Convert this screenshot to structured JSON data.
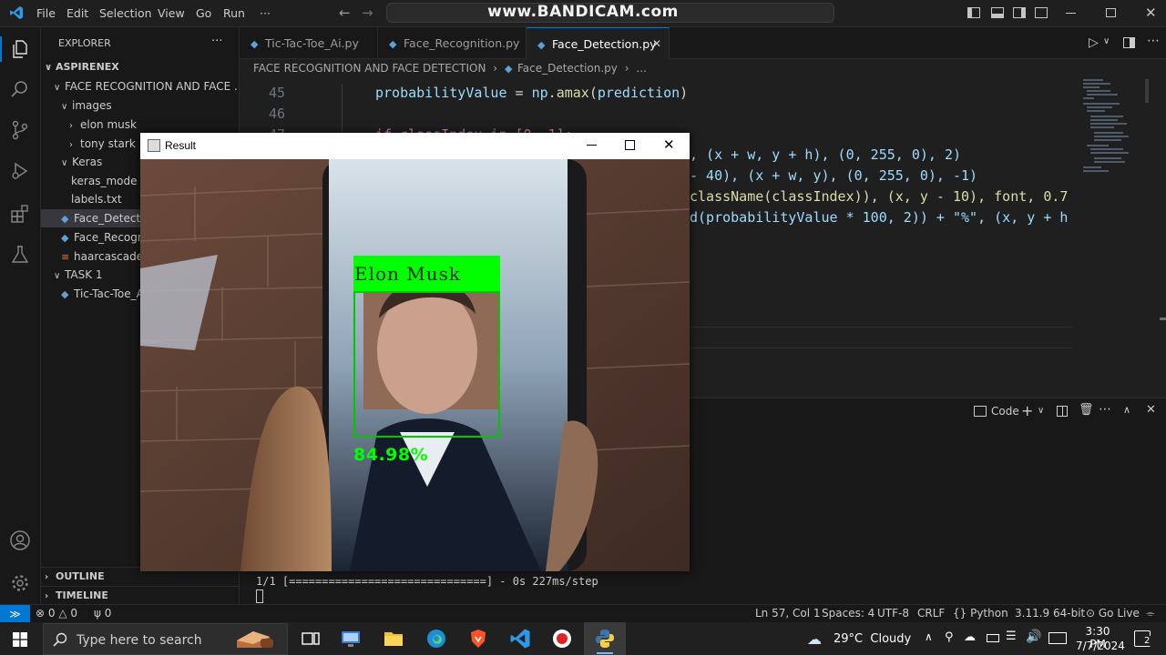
{
  "titlebar": {
    "menu": [
      "File",
      "Edit",
      "Selection",
      "View",
      "Go",
      "Run",
      "···"
    ],
    "watermark": "www.BANDICAM.com"
  },
  "sidebar": {
    "header": "EXPLORER",
    "more": "···",
    "workspace": "ASPIRENEX",
    "tree": [
      {
        "label": "FACE RECOGNITION AND FACE ...",
        "kind": "folder",
        "open": true
      },
      {
        "label": "images",
        "kind": "folder",
        "open": true
      },
      {
        "label": "elon musk",
        "kind": "folder",
        "open": false
      },
      {
        "label": "tony stark",
        "kind": "folder",
        "open": false
      },
      {
        "label": "Keras",
        "kind": "folder",
        "open": true
      },
      {
        "label": "keras_mode",
        "kind": "file"
      },
      {
        "label": "labels.txt",
        "kind": "file"
      },
      {
        "label": "Face_Detecti",
        "kind": "py",
        "selected": true
      },
      {
        "label": "Face_Recogn",
        "kind": "py"
      },
      {
        "label": "haarcascade_",
        "kind": "xml"
      },
      {
        "label": "TASK 1",
        "kind": "folder",
        "open": true
      },
      {
        "label": "Tic-Tac-Toe_A",
        "kind": "py"
      }
    ],
    "outline": "OUTLINE",
    "timeline": "TIMELINE"
  },
  "tabs": [
    {
      "label": "Tic-Tac-Toe_Ai.py",
      "active": false
    },
    {
      "label": "Face_Recognition.py",
      "active": false
    },
    {
      "label": "Face_Detection.py",
      "active": true,
      "close": "✕"
    }
  ],
  "breadcrumb": {
    "folder": "FACE RECOGNITION AND FACE DETECTION",
    "file": "Face_Detection.py",
    "tail": "..."
  },
  "editor": {
    "line_numbers": [
      "45",
      "46",
      "47"
    ],
    "lines": {
      "l45": [
        "probabilityValue",
        " = ",
        "np",
        ".",
        "amax",
        "(",
        "prediction",
        ")"
      ],
      "l47": "if classIndex in [0, 1]:",
      "l48": ", (x + w, y + h), (0, 255, 0), 2)",
      "l49": "- 40), (x + w, y), (0, 255, 0), -1)",
      "l50": "className(classIndex)), (x, y - 10), font, 0.7",
      "l51": "d(probabilityValue * 100, 2)) + \"%\", (x, y + h"
    }
  },
  "panel": {
    "code_label": "Code",
    "terminal_line": "1/1 [==============================] - 0s 227ms/step"
  },
  "result_window": {
    "title": "Result",
    "face_label": "Elon Musk",
    "probability": "84.98%"
  },
  "statusbar": {
    "errors": "0",
    "warnings": "0",
    "ports": "0",
    "position": "Ln 57, Col 1",
    "spaces": "Spaces: 4",
    "encoding": "UTF-8",
    "eol": "CRLF",
    "language": "Python",
    "interpreter": "3.11.9 64-bit",
    "golive": "Go Live"
  },
  "taskbar": {
    "search_placeholder": "Type here to search",
    "weather": "29°C  Cloudy",
    "time": "3:30 PM",
    "date": "7/7/2024",
    "notifications": "2"
  },
  "colors": {
    "accent": "#0078d4",
    "detection_green": "#00ff00"
  }
}
